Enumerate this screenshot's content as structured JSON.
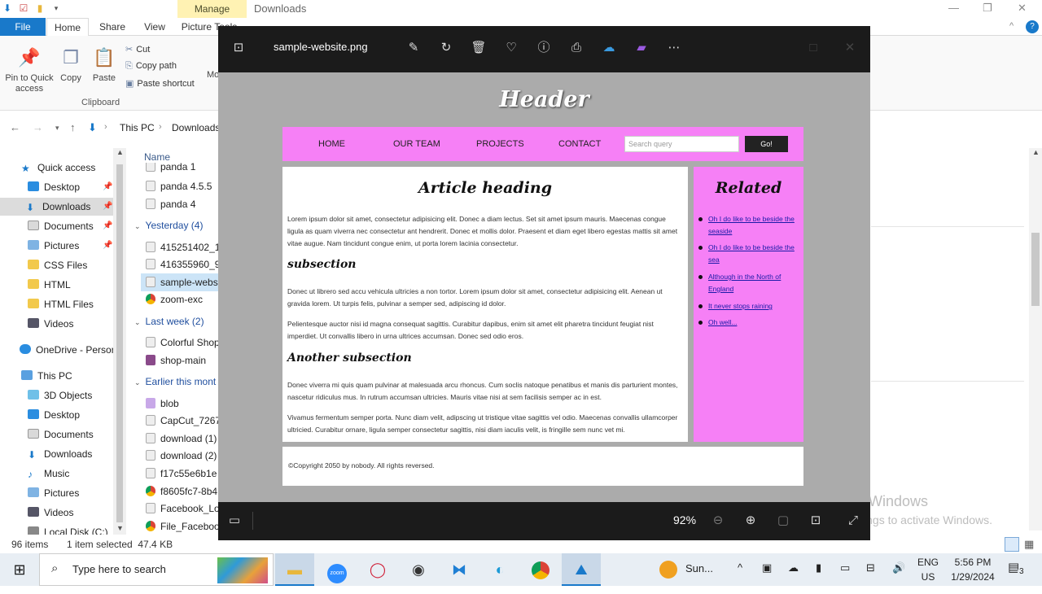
{
  "explorer": {
    "title_manage": "Manage",
    "window_title": "Downloads",
    "tabs": {
      "file": "File",
      "home": "Home",
      "share": "Share",
      "view": "View",
      "picture_tools": "Picture Tools"
    },
    "ribbon": {
      "pin": "Pin to Quick access",
      "copy": "Copy",
      "paste": "Paste",
      "cut": "Cut",
      "copy_path": "Copy path",
      "paste_shortcut": "Paste shortcut",
      "clipboard_group": "Clipboard",
      "move_partial": "Mo"
    },
    "address": {
      "this_pc": "This PC",
      "downloads": "Downloads",
      "sep": "›"
    },
    "sidebar": [
      {
        "label": "Quick access",
        "icon": "star-icon"
      },
      {
        "label": "Desktop",
        "icon": "desktop-icon"
      },
      {
        "label": "Downloads",
        "icon": "download-icon"
      },
      {
        "label": "Documents",
        "icon": "documents-icon"
      },
      {
        "label": "Pictures",
        "icon": "pictures-icon"
      },
      {
        "label": "CSS Files",
        "icon": "folder-icon"
      },
      {
        "label": "HTML",
        "icon": "folder-icon"
      },
      {
        "label": "HTML Files",
        "icon": "folder-icon"
      },
      {
        "label": "Videos",
        "icon": "videos-icon"
      },
      {
        "label": "OneDrive - Person",
        "icon": "cloud-icon"
      },
      {
        "label": "This PC",
        "icon": "pc-icon"
      },
      {
        "label": "3D Objects",
        "icon": "3d-icon"
      },
      {
        "label": "Desktop",
        "icon": "desktop-icon"
      },
      {
        "label": "Documents",
        "icon": "documents-icon"
      },
      {
        "label": "Downloads",
        "icon": "download-icon"
      },
      {
        "label": "Music",
        "icon": "music-icon"
      },
      {
        "label": "Pictures",
        "icon": "pictures-icon"
      },
      {
        "label": "Videos",
        "icon": "videos-icon"
      },
      {
        "label": "Local Disk (C:)",
        "icon": "disk-icon"
      }
    ],
    "file_header": "Name",
    "files": [
      {
        "label": "panda 1"
      },
      {
        "label": "panda 4.5.5"
      },
      {
        "label": "panda 4"
      },
      {
        "label": "Yesterday (4)",
        "group": true
      },
      {
        "label": "415251402_1"
      },
      {
        "label": "416355960_9"
      },
      {
        "label": "sample-websi",
        "selected": true
      },
      {
        "label": "zoom-exc"
      },
      {
        "label": "Last week (2)",
        "group": true
      },
      {
        "label": "Colorful Shop"
      },
      {
        "label": "shop-main"
      },
      {
        "label": "Earlier this mont",
        "group": true
      },
      {
        "label": "blob"
      },
      {
        "label": "CapCut_7267"
      },
      {
        "label": "download (1)"
      },
      {
        "label": "download (2)"
      },
      {
        "label": "f17c55e6b1e"
      },
      {
        "label": "f8605fc7-8b4"
      },
      {
        "label": "Facebook_Lo"
      },
      {
        "label": "File_Faceboo"
      }
    ],
    "status_items": "96 items",
    "status_selected": "1 item selected  47.4 KB"
  },
  "viewer": {
    "filename": "sample-website.png",
    "zoom": "92%",
    "site": {
      "header": "Header",
      "nav": [
        "HOME",
        "OUR TEAM",
        "PROJECTS",
        "CONTACT"
      ],
      "search_placeholder": "Search query",
      "go": "Go!",
      "article_heading": "Article heading",
      "p1": "Lorem ipsum dolor sit amet, consectetur adipisicing elit. Donec a diam lectus. Set sit amet ipsum mauris. Maecenas congue ligula as quam viverra nec consectetur ant hendrerit. Donec et mollis dolor. Praesent et diam eget libero egestas mattis sit amet vitae augue. Nam tincidunt congue enim, ut porta lorem lacinia consectetur.",
      "subsection": "subsection",
      "p2": "Donec ut librero sed accu vehicula ultricies a non tortor. Lorem ipsum dolor sit amet, consectetur adipisicing elit. Aenean ut gravida lorem. Ut turpis felis, pulvinar a semper sed, adipiscing id dolor.",
      "p3": "Pelientesque auctor nisi id magna consequat sagittis. Curabitur dapibus, enim sit amet elit pharetra tincidunt feugiat nist imperdiet. Ut convallis libero in urna ultrices accumsan. Donec sed odio eros.",
      "another_subsection": "Another subsection",
      "p4": "Donec viverra mi quis quam pulvinar at malesuada arcu rhoncus. Cum soclis natoque penatibus et manis dis parturient montes, nascetur ridiculus mus. In rutrum accumsan ultricies. Mauris vitae nisi at sem facilisis semper ac in est.",
      "p5": "Vivamus fermentum semper porta. Nunc diam velit, adipscing ut tristique vitae sagittis vel odio. Maecenas convallis ullamcorper ultricied. Curabitur ornare, ligula semper consectetur sagittis, nisi diam iaculis velit, is fringille sem nunc vet mi.",
      "related_heading": "Related",
      "related": [
        "Oh I do like to be beside the seaside",
        "Oh I do like to be beside the sea",
        "Although in the North of England",
        "It never stops raining",
        "Oh well..."
      ],
      "footer": "©Copyright 2050 by nobody. All rights reversed."
    }
  },
  "watermark": {
    "line1": "Activate Windows",
    "line2": "Go to Settings to activate Windows."
  },
  "taskbar": {
    "search_placeholder": "Type here to search",
    "weather": "Sun...",
    "lang1": "ENG",
    "lang2": "US",
    "time": "5:56 PM",
    "date": "1/29/2024",
    "notif_count": "3"
  },
  "colors": {
    "accent": "#1979ca",
    "site_pink": "#f680f6",
    "manage_tab": "#fff2b3"
  }
}
